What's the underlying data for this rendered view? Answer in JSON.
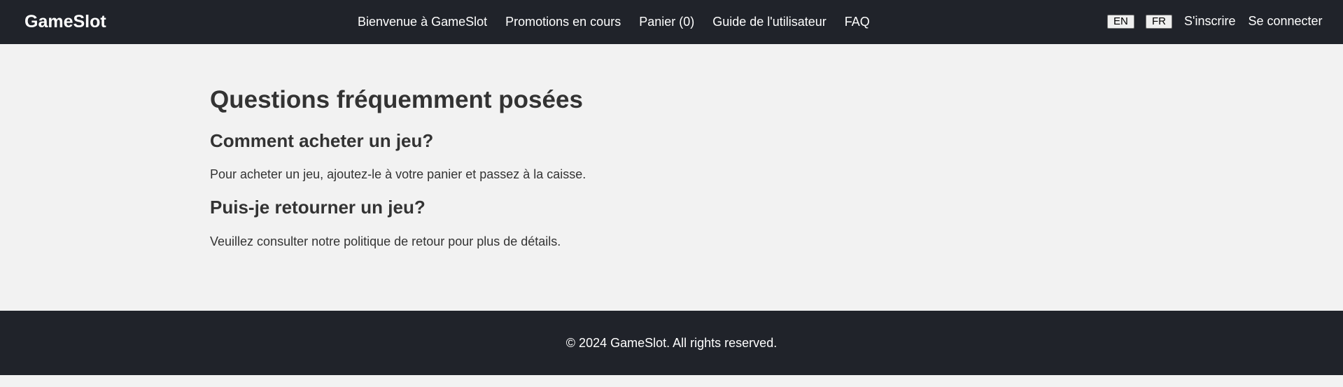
{
  "header": {
    "logo": "GameSlot",
    "nav": [
      {
        "label": "Bienvenue à GameSlot"
      },
      {
        "label": "Promotions en cours"
      },
      {
        "label": "Panier (0)"
      },
      {
        "label": "Guide de l'utilisateur"
      },
      {
        "label": "FAQ"
      }
    ],
    "languages": {
      "en": "EN",
      "fr": "FR"
    },
    "auth": {
      "signup": "S'inscrire",
      "login": "Se connecter"
    }
  },
  "main": {
    "title": "Questions fréquemment posées",
    "faq": [
      {
        "question": "Comment acheter un jeu?",
        "answer": "Pour acheter un jeu, ajoutez-le à votre panier et passez à la caisse."
      },
      {
        "question": "Puis-je retourner un jeu?",
        "answer": "Veuillez consulter notre politique de retour pour plus de détails."
      }
    ]
  },
  "footer": {
    "copyright": "© 2024 GameSlot. All rights reserved."
  },
  "colors": {
    "header_bg": "#20232a",
    "page_bg": "#f2f2f2",
    "text": "#333333"
  }
}
